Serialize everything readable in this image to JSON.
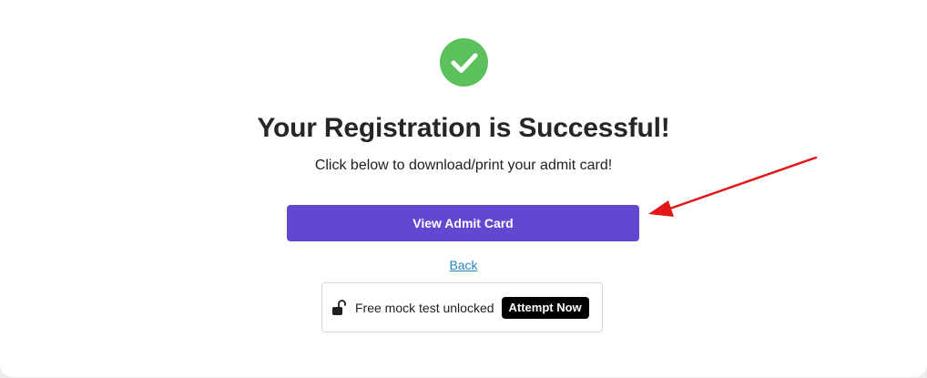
{
  "success": {
    "icon": "check-circle-icon",
    "color": "#5cc15c"
  },
  "title": "Your Registration is Successful!",
  "subtitle": "Click below to download/print your admit card!",
  "primary_button": {
    "label": "View Admit Card",
    "color": "#6247d0"
  },
  "annotation": {
    "icon": "red-arrow-icon",
    "color": "#e01818"
  },
  "back_link": "Back",
  "mock_test": {
    "icon": "unlocked-padlock-icon",
    "text": "Free mock test unlocked",
    "button_label": "Attempt Now"
  }
}
